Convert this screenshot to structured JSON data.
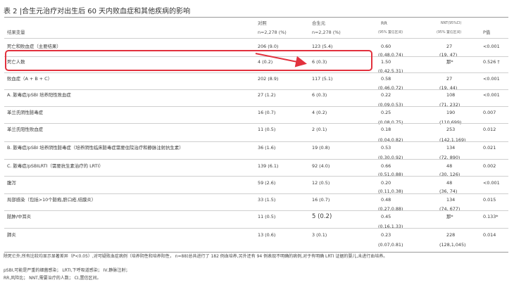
{
  "title": "表 2 |合生元治疗对出生后 60 天内败血症和其他疾病的影响",
  "header": {
    "outcome": "结果变量",
    "control": "对照",
    "control_n": "n=2,278 (%)",
    "synbiotic": "合生元",
    "synbiotic_n": "n=2,278 (%)",
    "rr": "RR",
    "rr_sub": "(95% 置信区间)",
    "nnt": "NNT(95%CI)",
    "nnt_sub": "(95% 置信区间)",
    "p": "P值"
  },
  "rows": [
    {
      "label": "死亡和败血症（主要结果）",
      "control": "206 (9.0)",
      "synbiotic": "123  (5.4)",
      "rr": "0.60",
      "nnt": "27",
      "p": "<0.001",
      "ci": "(0.48,0.74)",
      "nnt_ci": "(19, 47)"
    },
    {
      "label": "死亡人数",
      "control": "4 (0.2)",
      "synbiotic": "6 (0.3)",
      "rr": "1.50",
      "nnt": "那*",
      "p": "0.526 †",
      "ci": "(0.42,5.31)",
      "nnt_ci": ""
    },
    {
      "label": "败血症（A + B + C）",
      "control": "202 (8.9)",
      "synbiotic": "117 (5.1)",
      "rr": "0.58",
      "nnt": "27",
      "p": "<0.001",
      "ci": "(0.46,0.72)",
      "nnt_ci": "(19, 44)"
    },
    {
      "label": "A. 脓毒症/pSBI   培养阳性败血症",
      "control": "27 (1.2)",
      "synbiotic": "6 (0.3)",
      "rr": "0.22",
      "nnt": "108",
      "p": "<0.001",
      "ci": "(0.09,0.53)",
      "nnt_ci": "(71, 232)"
    },
    {
      "label": "革兰氏阴性脓毒症",
      "control": "16 (0.7)",
      "synbiotic": "4   (0.2)",
      "rr": "0.25",
      "nnt": "190",
      "p": "0.007",
      "ci": "(0.08,0.75)",
      "nnt_ci": "(110,699)"
    },
    {
      "label": "革兰氏阳性败血症",
      "control": "11  (0.5)",
      "synbiotic": "2 (0.1)",
      "rr": "0.18",
      "nnt": "253",
      "p": "0.012",
      "ci": "(0.04,0.82)",
      "nnt_ci": "(142,1,169)"
    },
    {
      "label": "B. 脓毒症/pSBI    培养阴性脓毒症（培养阴性临床脓毒症需要住院治疗和静脉注射抗生素）",
      "control": "36  (1.6)",
      "synbiotic": "19 (0.8)",
      "rr": "0.53",
      "nnt": "134",
      "p": "0.021",
      "ci": "(0.30,0.92)",
      "nnt_ci": "(72, 890)"
    },
    {
      "label": "C. 脓毒症/pSBILRTI（需要抗生素治疗的 LRTI）",
      "control": "139 (6.1)",
      "synbiotic": "92 (4.0)",
      "rr": "0.66",
      "nnt": "48",
      "p": "0.002",
      "ci": "(0.51,0.88)",
      "nnt_ci": "(30, 126)"
    },
    {
      "label": "腹泻",
      "control": "59 (2.6)",
      "synbiotic": "12 (0.5)",
      "rr": "0.20",
      "nnt": "48",
      "p": "<0.001",
      "ci": "(0.11,0.38)",
      "nnt_ci": "(36, 74)"
    },
    {
      "label": "局部感染（包括>10个脓疱,脐口疮,结膜炎）",
      "control": "33 (1.5)",
      "synbiotic": "16 (0.7)",
      "rr": "0.48",
      "nnt": "134",
      "p": "0.015",
      "ci": "(0.27,0.88)",
      "nnt_ci": "(74, 677)"
    },
    {
      "label": "脓肿/中耳炎",
      "control": "11 (0.5)",
      "synbiotic": "5  (0.2)",
      "rr": "0.45",
      "nnt": "那*",
      "p": "0.133*",
      "ci": "(0.16,1.33)",
      "nnt_ci": ""
    },
    {
      "label": "肺炎",
      "control": "13 (0.6)",
      "synbiotic": "3  (0.1)",
      "rr": "0.23",
      "nnt": "228",
      "p": "0.014",
      "ci": "(0.07,0.81)",
      "nnt_ci": "(128,1,045)"
    }
  ],
  "notes": [
    "除死亡外,所有比较均显示显著差异（P<0.05）,对可疑败血症病例（培养阴性和培养阳性， n=88)总共进行了 182 例血培养,另外还有 94 例表现不明确的病例,对于有明确 LRTI 证据的婴儿,未进行血培养。",
    "pSBI,可能是严重的细菌感染；  LRTI,下呼吸道感染；  IV,静脉注射；",
    "RR,风险比；  NNT,需要治疗的人数；  CI,置信区间。"
  ],
  "colors": {
    "highlight": "#e2313d",
    "arrow": "#e2313d"
  }
}
